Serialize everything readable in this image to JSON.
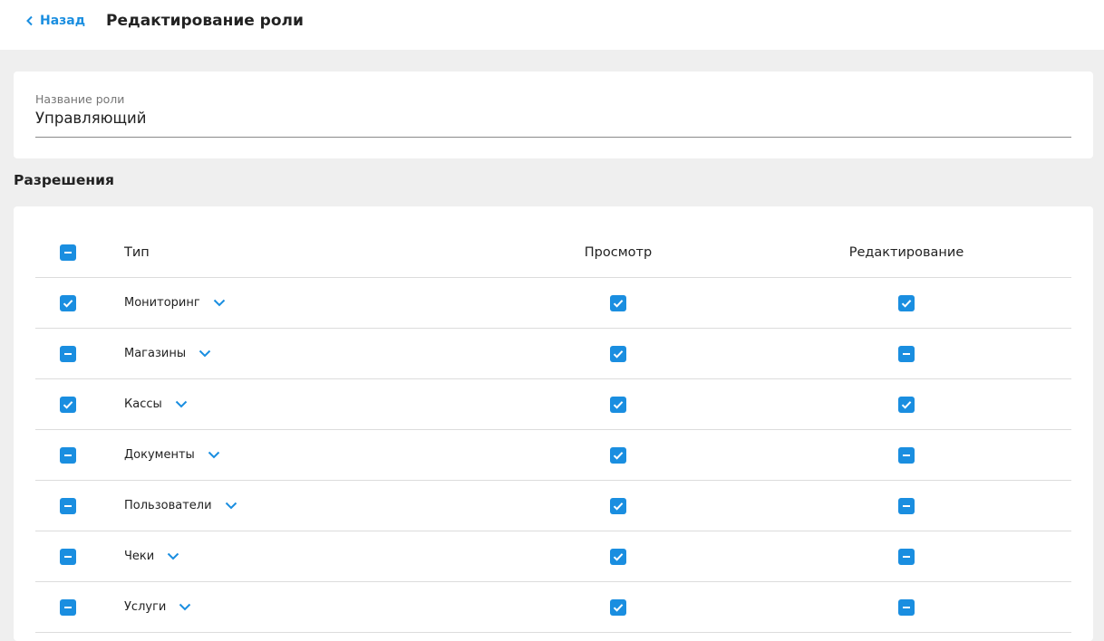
{
  "header": {
    "back_label": "Назад",
    "title": "Редактирование роли"
  },
  "role": {
    "label": "Название роли",
    "value": "Управляющий"
  },
  "permissions": {
    "section_title": "Разрешения",
    "columns": {
      "type": "Тип",
      "view": "Просмотр",
      "edit": "Редактирование"
    },
    "header_state": "indeterminate",
    "rows": [
      {
        "name": "Мониторинг",
        "select": "checked",
        "view": "checked",
        "edit": "checked"
      },
      {
        "name": "Магазины",
        "select": "indeterminate",
        "view": "checked",
        "edit": "indeterminate"
      },
      {
        "name": "Кассы",
        "select": "checked",
        "view": "checked",
        "edit": "checked"
      },
      {
        "name": "Документы",
        "select": "indeterminate",
        "view": "checked",
        "edit": "indeterminate"
      },
      {
        "name": "Пользователи",
        "select": "indeterminate",
        "view": "checked",
        "edit": "indeterminate"
      },
      {
        "name": "Чеки",
        "select": "indeterminate",
        "view": "checked",
        "edit": "indeterminate"
      },
      {
        "name": "Услуги",
        "select": "indeterminate",
        "view": "checked",
        "edit": "indeterminate"
      }
    ]
  },
  "colors": {
    "accent": "#1a8ee0",
    "page_bg": "#efefef",
    "card_bg": "#ffffff"
  },
  "icons": {
    "back": "chevron-left-icon",
    "expand": "chevron-down-icon",
    "checked": "check-icon",
    "indeterminate": "minus-icon"
  }
}
